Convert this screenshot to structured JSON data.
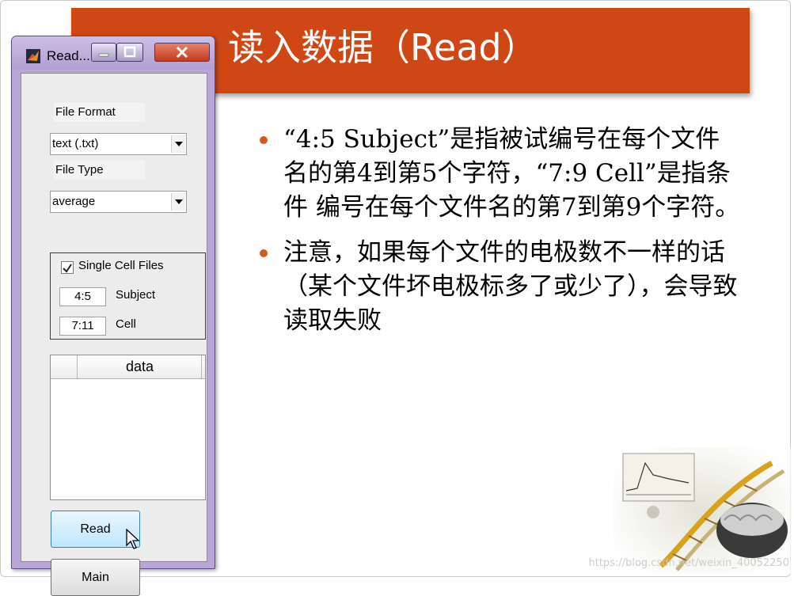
{
  "slide": {
    "title": "读入数据（Read）",
    "bullets": [
      "“4:5 Subject”是指被试编号在每个文件名的第4到第5个字符，“7:9 Cell”是指条件 编号在每个文件名的第7到第9个字符。",
      "注意，如果每个文件的电极数不一样的话（某个文件坏电极标多了或少了），会导致读取失败"
    ],
    "watermark": "https://blog.csdn.net/weixin_40052250",
    "accent_color": "#cf4714"
  },
  "window": {
    "title": "Read...",
    "app_icon": "matlab-icon",
    "controls": {
      "minimize": "minimize-icon",
      "maximize": "maximize-icon",
      "close": "close-icon"
    },
    "file_format_label": "File Format",
    "file_format_value": "text (.txt)",
    "file_type_label": "File Type",
    "file_type_value": "average",
    "single_cell": {
      "checked": true,
      "label": "Single Cell Files",
      "subject_range": "4:5",
      "subject_label": "Subject",
      "cell_range": "7:11",
      "cell_label": "Cell"
    },
    "table": {
      "columns": [
        "data"
      ]
    },
    "read_button": "Read",
    "main_button": "Main"
  }
}
